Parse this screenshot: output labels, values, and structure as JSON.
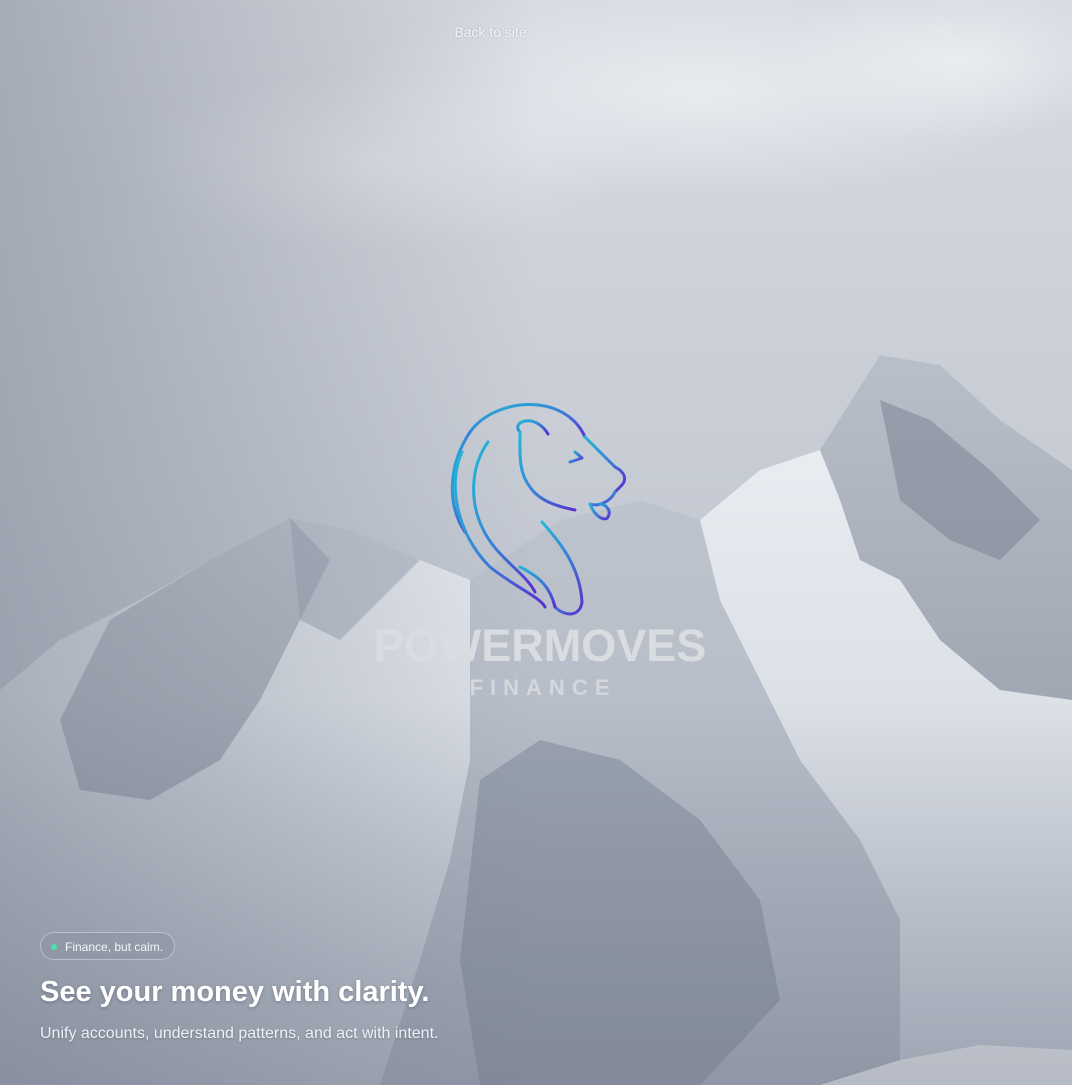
{
  "nav": {
    "back_label": "Back to site"
  },
  "brand": {
    "name": "POWERMOVES",
    "tagline": "FINANCE",
    "gradient": [
      "#22b8d6",
      "#5a2fd0"
    ]
  },
  "hero": {
    "badge": {
      "label": "Finance, but calm.",
      "dot_color": "#4be3b0"
    },
    "headline": "See your money with clarity.",
    "subheadline": "Unify accounts, understand patterns, and act with intent."
  },
  "background": {
    "description_icon": "snowy-mountain-photo"
  }
}
